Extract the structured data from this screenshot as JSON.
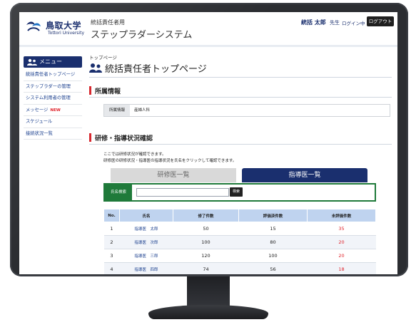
{
  "header": {
    "university_jp": "鳥取大学",
    "university_en": "Tottori University",
    "system_subtitle": "統括責任者用",
    "system_title": "ステップラダーシステム",
    "user_name": "統括 太郎",
    "user_honorific": "先生",
    "login_status": "ログイン中",
    "logout_label": "ログアウト"
  },
  "sidebar": {
    "title": "メニュー",
    "items": [
      {
        "label": "統括責任者トップページ"
      },
      {
        "label": "ステップラダーの管理"
      },
      {
        "label": "システム利用者の管理"
      },
      {
        "label": "メッセージ",
        "badge": "NEW"
      },
      {
        "label": "スケジュール"
      },
      {
        "label": "接続状況一覧"
      }
    ]
  },
  "main": {
    "breadcrumb": "トップページ",
    "page_title": "統括責任者トップページ",
    "affiliation_section": {
      "title": "所属情報",
      "label": "所属情報",
      "value": "産婦人科"
    },
    "training_section": {
      "title": "研修・指導状況確認",
      "desc1": "ここでは研修状況が確認できます。",
      "desc2": "研修医の研修状況・指導医の指導状況を氏名をクリックして確認できます。",
      "tabs": [
        {
          "label": "研修医一覧",
          "active": false
        },
        {
          "label": "指導医一覧",
          "active": true
        }
      ],
      "search": {
        "label": "氏名検索",
        "value": "",
        "button": "検索"
      },
      "table": {
        "headers": [
          "No.",
          "氏名",
          "修了件数",
          "評価済件数",
          "未評価件数"
        ],
        "rows": [
          {
            "no": "1",
            "name": "指導医　太郎",
            "a": "50",
            "b": "15",
            "c": "35"
          },
          {
            "no": "2",
            "name": "指導医　次郎",
            "a": "100",
            "b": "80",
            "c": "20"
          },
          {
            "no": "3",
            "name": "指導医　三郎",
            "a": "120",
            "b": "100",
            "c": "20"
          },
          {
            "no": "4",
            "name": "指導医　四郎",
            "a": "74",
            "b": "56",
            "c": "18"
          }
        ]
      }
    }
  },
  "colors": {
    "brand_navy": "#1a2f6e",
    "accent_red": "#d7282f",
    "search_green": "#1f7a3a",
    "table_header": "#bfd3ef"
  }
}
